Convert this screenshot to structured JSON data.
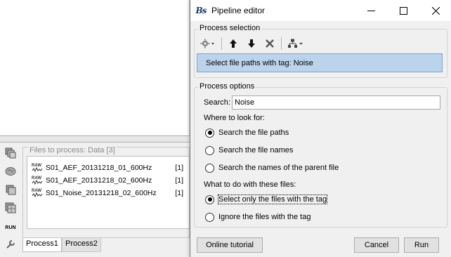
{
  "background": {
    "files_panel_title": "Files to process: Data [3]",
    "files": [
      {
        "name": "S01_AEF_20131218_01_600Hz",
        "count": "[1]",
        "icon": "raw-file-icon"
      },
      {
        "name": "S01_AEF_20131218_02_600Hz",
        "count": "[1]",
        "icon": "raw-file-icon"
      },
      {
        "name": "S01_Noise_20131218_02_600Hz",
        "count": "[1]",
        "icon": "raw-file-icon"
      }
    ],
    "raw_label": "RAW",
    "run_label": "RUN",
    "tabs": [
      {
        "label": "Process1",
        "active": true
      },
      {
        "label": "Process2",
        "active": false
      }
    ]
  },
  "window": {
    "title": "Pipeline editor",
    "logo": "Bs",
    "controls": [
      "minimize-icon",
      "maximize-icon",
      "close-icon"
    ]
  },
  "process_selection": {
    "title": "Process selection",
    "toolbar_icons": [
      "gear-dropdown-icon",
      "arrow-up-icon",
      "arrow-down-icon",
      "delete-icon",
      "pipeline-dropdown-icon"
    ],
    "selected_process": "Select file paths with tag: Noise"
  },
  "process_options": {
    "title": "Process options",
    "search_label": "Search:",
    "search_value": "Noise",
    "where_label": "Where to look for:",
    "where_options": [
      {
        "label": "Search the file paths",
        "checked": true
      },
      {
        "label": "Search the file names",
        "checked": false
      },
      {
        "label": "Search the names of the parent file",
        "checked": false
      }
    ],
    "what_label": "What to do with these files:",
    "what_options": [
      {
        "label": "Select only the files with the tag",
        "checked": true
      },
      {
        "label": "Ignore the files with the tag",
        "checked": false
      }
    ]
  },
  "buttons": {
    "tutorial": "Online tutorial",
    "cancel": "Cancel",
    "run": "Run"
  },
  "colors": {
    "selection_bg": "#bcd3ec",
    "selection_border": "#7aa3cf",
    "window_bg": "#f0f0f0"
  }
}
